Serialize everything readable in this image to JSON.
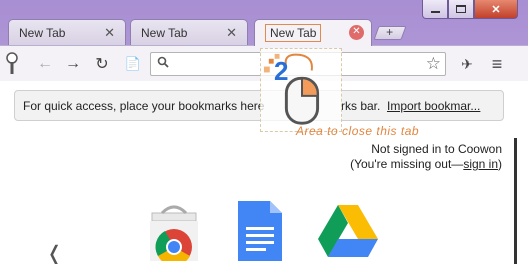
{
  "window": {
    "controls": {
      "minimize": "",
      "maximize": "",
      "close": "✕"
    }
  },
  "tabs": [
    {
      "title": "New Tab",
      "close": "✕"
    },
    {
      "title": "New Tab",
      "close": "✕"
    },
    {
      "title": "New Tab",
      "close": "✕"
    }
  ],
  "new_tab_button": "+",
  "toolbar": {
    "back": "←",
    "forward": "→",
    "reload": "↻",
    "page": "📄",
    "search_icon": "🔍",
    "star": "☆",
    "extension": "✈",
    "menu": "≡"
  },
  "bookmarks_bar": {
    "message": "For quick access, place your bookmarks here",
    "message_tail": "rks bar.",
    "import_link": "Import bookmar..."
  },
  "signin": {
    "line1": "Not signed in to Coowon",
    "line2_prefix": "(You're missing out—",
    "link": "sign in",
    "line2_suffix": ")"
  },
  "tutorial": {
    "step": "2",
    "caption": "Area to close this tab"
  },
  "apps": [
    {
      "name": "chrome-web-store",
      "icon": "web-store-icon"
    },
    {
      "name": "google-docs",
      "icon": "docs-icon"
    },
    {
      "name": "google-drive",
      "icon": "drive-icon"
    }
  ],
  "prev_arrow": "❬",
  "colors": {
    "accent_orange": "#e2863f",
    "close_highlight": "#e06b6b",
    "frame_purple": "#a88ed2"
  }
}
